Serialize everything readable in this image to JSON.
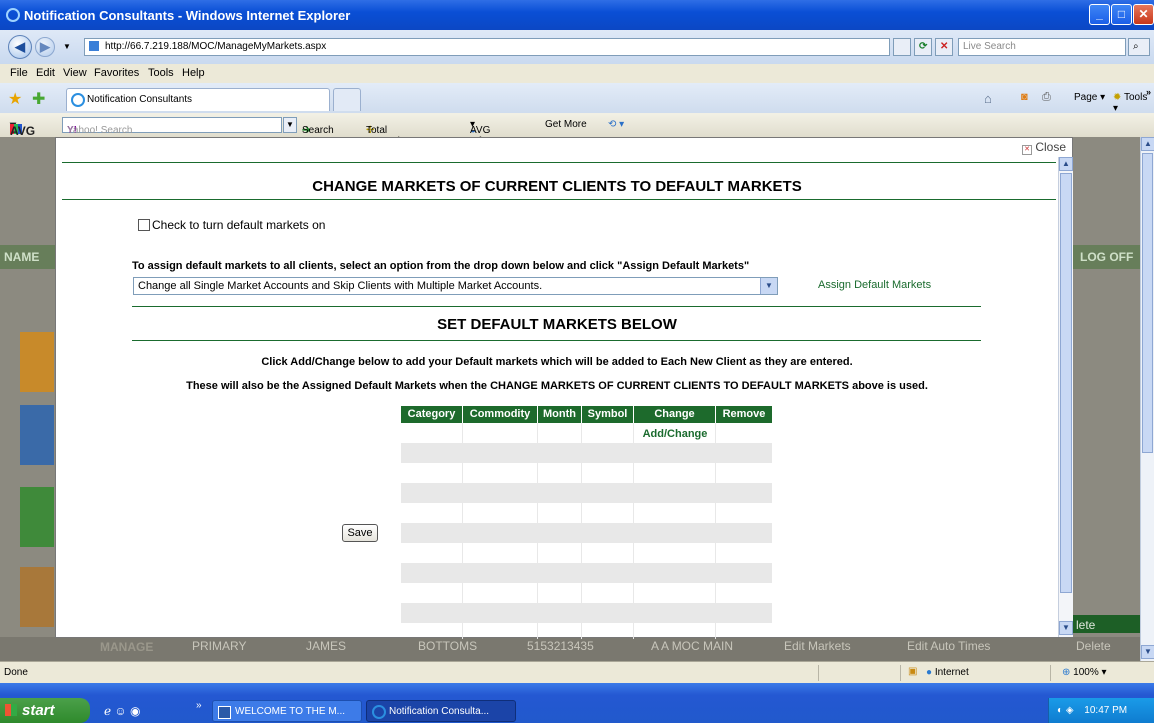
{
  "window": {
    "title": "Notification Consultants - Windows Internet Explorer"
  },
  "address": {
    "url": "http://66.7.219.188/MOC/ManageMyMarkets.aspx",
    "search_placeholder": "Live Search"
  },
  "menu": [
    "File",
    "Edit",
    "View",
    "Favorites",
    "Tools",
    "Help"
  ],
  "tabs": {
    "active": "Notification Consultants"
  },
  "commandbar": {
    "page": "Page",
    "tools": "Tools"
  },
  "avgbar": {
    "brand": "AVG",
    "search_placeholder": "Yahoo! Search",
    "search_label": "Search",
    "total_protection": "Total Protection",
    "avg_info": "AVG Info",
    "get_more": "Get More"
  },
  "background": {
    "name_label": "NAME",
    "logoff_label": "LOG OFF",
    "manage_label": "MANAGE",
    "delete_label_top": "lete",
    "row": [
      "PRIMARY",
      "JAMES",
      "BOTTOMS",
      "5153213435",
      "A A MOC MAIN",
      "Edit Markets",
      "Edit Auto Times",
      "Delete"
    ]
  },
  "modal": {
    "close_label": "Close",
    "title": "CHANGE MARKETS OF CURRENT CLIENTS TO DEFAULT MARKETS",
    "checkbox_label": "Check to turn default markets on",
    "assign_instruction": "To assign default markets to all clients, select an option from the drop down below and click \"Assign Default Markets\"",
    "dropdown_value": "Change all Single Market Accounts and Skip Clients with Multiple Market Accounts.",
    "assign_link": "Assign Default Markets",
    "section_title": "SET DEFAULT MARKETS BELOW",
    "info_line1": "Click Add/Change below to add your Default markets which will be added to Each New Client as they are entered.",
    "info_line2": "These will also be the Assigned Default Markets when the CHANGE MARKETS OF CURRENT CLIENTS TO DEFAULT MARKETS above is used.",
    "table": {
      "headers": [
        "Category",
        "Commodity",
        "Month",
        "Symbol",
        "Change",
        "Remove"
      ],
      "add_change": "Add/Change"
    },
    "save_label": "Save"
  },
  "status": {
    "text": "Done",
    "zone": "Internet",
    "zoom": "100%"
  },
  "taskbar": {
    "start": "start",
    "items": [
      "WELCOME TO THE M...",
      "Notification Consulta..."
    ],
    "clock": "10:47 PM"
  }
}
